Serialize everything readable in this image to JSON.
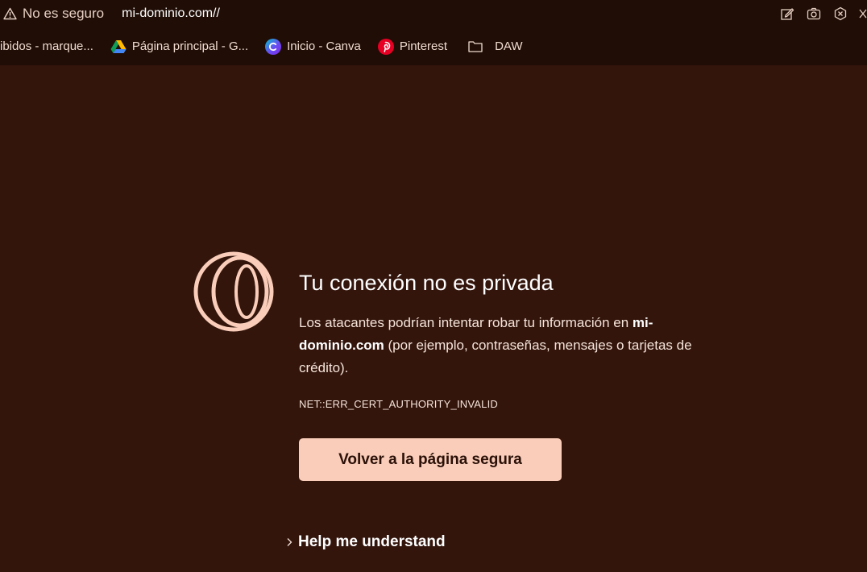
{
  "address_bar": {
    "security_label": "No es seguro",
    "url": "mi-dominio.com//",
    "security_icon": "warning-triangle-icon",
    "actions": [
      {
        "icon": "edit-icon"
      },
      {
        "icon": "camera-icon"
      },
      {
        "icon": "close-circle-icon"
      },
      {
        "icon": "more-icon"
      }
    ]
  },
  "bookmarks": [
    {
      "label": "ibidos - marque...",
      "icon": "none"
    },
    {
      "label": "Página principal - G...",
      "icon": "google-drive-icon"
    },
    {
      "label": "Inicio - Canva",
      "icon": "canva-icon"
    },
    {
      "label": "Pinterest",
      "icon": "pinterest-icon"
    },
    {
      "label": "DAW",
      "icon": "folder-icon"
    }
  ],
  "error": {
    "logo": "opera-gx-logo",
    "title": "Tu conexión no es privada",
    "desc_before": "Los atacantes podrían intentar robar tu información en ",
    "desc_domain": "mi-dominio.com",
    "desc_after": " (por ejemplo, contraseñas, mensajes o tarjetas de crédito).",
    "code": "NET::ERR_CERT_AUTHORITY_INVALID",
    "back_button": "Volver a la página segura",
    "help_label": "Help me understand"
  },
  "colors": {
    "background": "#33150c",
    "toolbar": "#1f0d06",
    "accent": "#f9cdb9",
    "text": "#f6e4da"
  }
}
